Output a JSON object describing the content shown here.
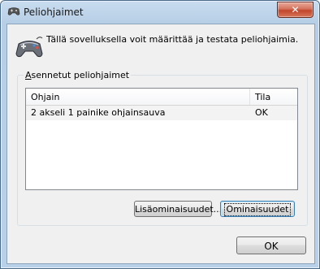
{
  "window": {
    "title": "Peliohjaimet",
    "close_glyph": "✕"
  },
  "intro": {
    "text": "Tällä sovelluksella voit määrittää ja testata peliohjaimia.",
    "icon": "gamepad-icon"
  },
  "group": {
    "label": "Asennetut peliohjaimet"
  },
  "list": {
    "columns": [
      "Ohjain",
      "Tila"
    ],
    "rows": [
      {
        "name": "2 akseli 1 painike ohjainsauva",
        "status": "OK"
      }
    ]
  },
  "buttons": {
    "advanced": "Lisäominaisuudet...",
    "properties": "Ominaisuudet",
    "ok": "OK"
  }
}
